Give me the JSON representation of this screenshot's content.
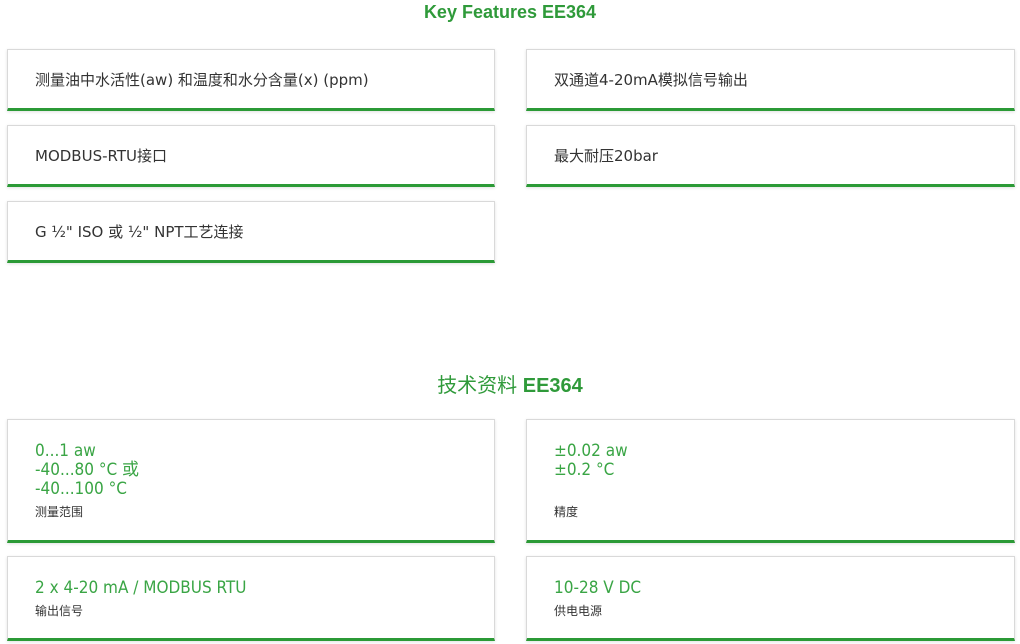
{
  "key_features": {
    "title": "Key Features EE364",
    "items": [
      "测量油中水活性(aw) 和温度和水分含量(x) (ppm)",
      "双通道4-20mA模拟信号输出",
      "MODBUS-RTU接口",
      "最大耐压20bar",
      "G ½\" ISO 或 ½\" NPT工艺连接"
    ]
  },
  "technical_data": {
    "title_prefix": "技术资料",
    "title_model": "EE364",
    "items": [
      {
        "values": [
          "0...1 aw",
          "-40...80 °C 或",
          "-40...100 °C"
        ],
        "label": "测量范围"
      },
      {
        "values": [
          "±0.02 aw",
          "±0.2 °C"
        ],
        "label": "精度"
      },
      {
        "values": [
          "2 x 4-20 mA / MODBUS RTU"
        ],
        "label": "输出信号"
      },
      {
        "values": [
          "10-28 V DC"
        ],
        "label": "供电电源"
      }
    ]
  },
  "colors": {
    "accent": "#2b9a36",
    "value_text": "#3aa545",
    "border": "#d9d9d9"
  }
}
